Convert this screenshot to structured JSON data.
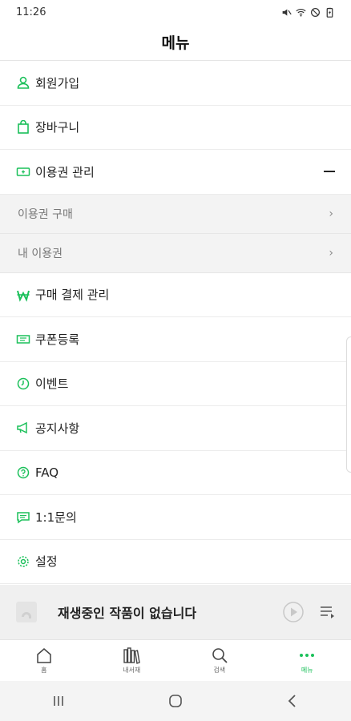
{
  "status": {
    "time": "11:26"
  },
  "header": {
    "title": "메뉴"
  },
  "menu": {
    "signup": "회원가입",
    "cart": "장바구니",
    "pass_manage": "이용권 관리",
    "pass_buy": "이용권 구매",
    "my_pass": "내 이용권",
    "payment_manage": "구매 결제 관리",
    "coupon": "쿠폰등록",
    "event": "이벤트",
    "notice": "공지사항",
    "faq": "FAQ",
    "inquiry": "1:1문의",
    "settings": "설정"
  },
  "player": {
    "title": "재생중인 작품이 없습니다"
  },
  "tabs": {
    "home": "홈",
    "library": "내서재",
    "search": "검색",
    "menu": "메뉴"
  },
  "colors": {
    "accent": "#1bc05a"
  }
}
